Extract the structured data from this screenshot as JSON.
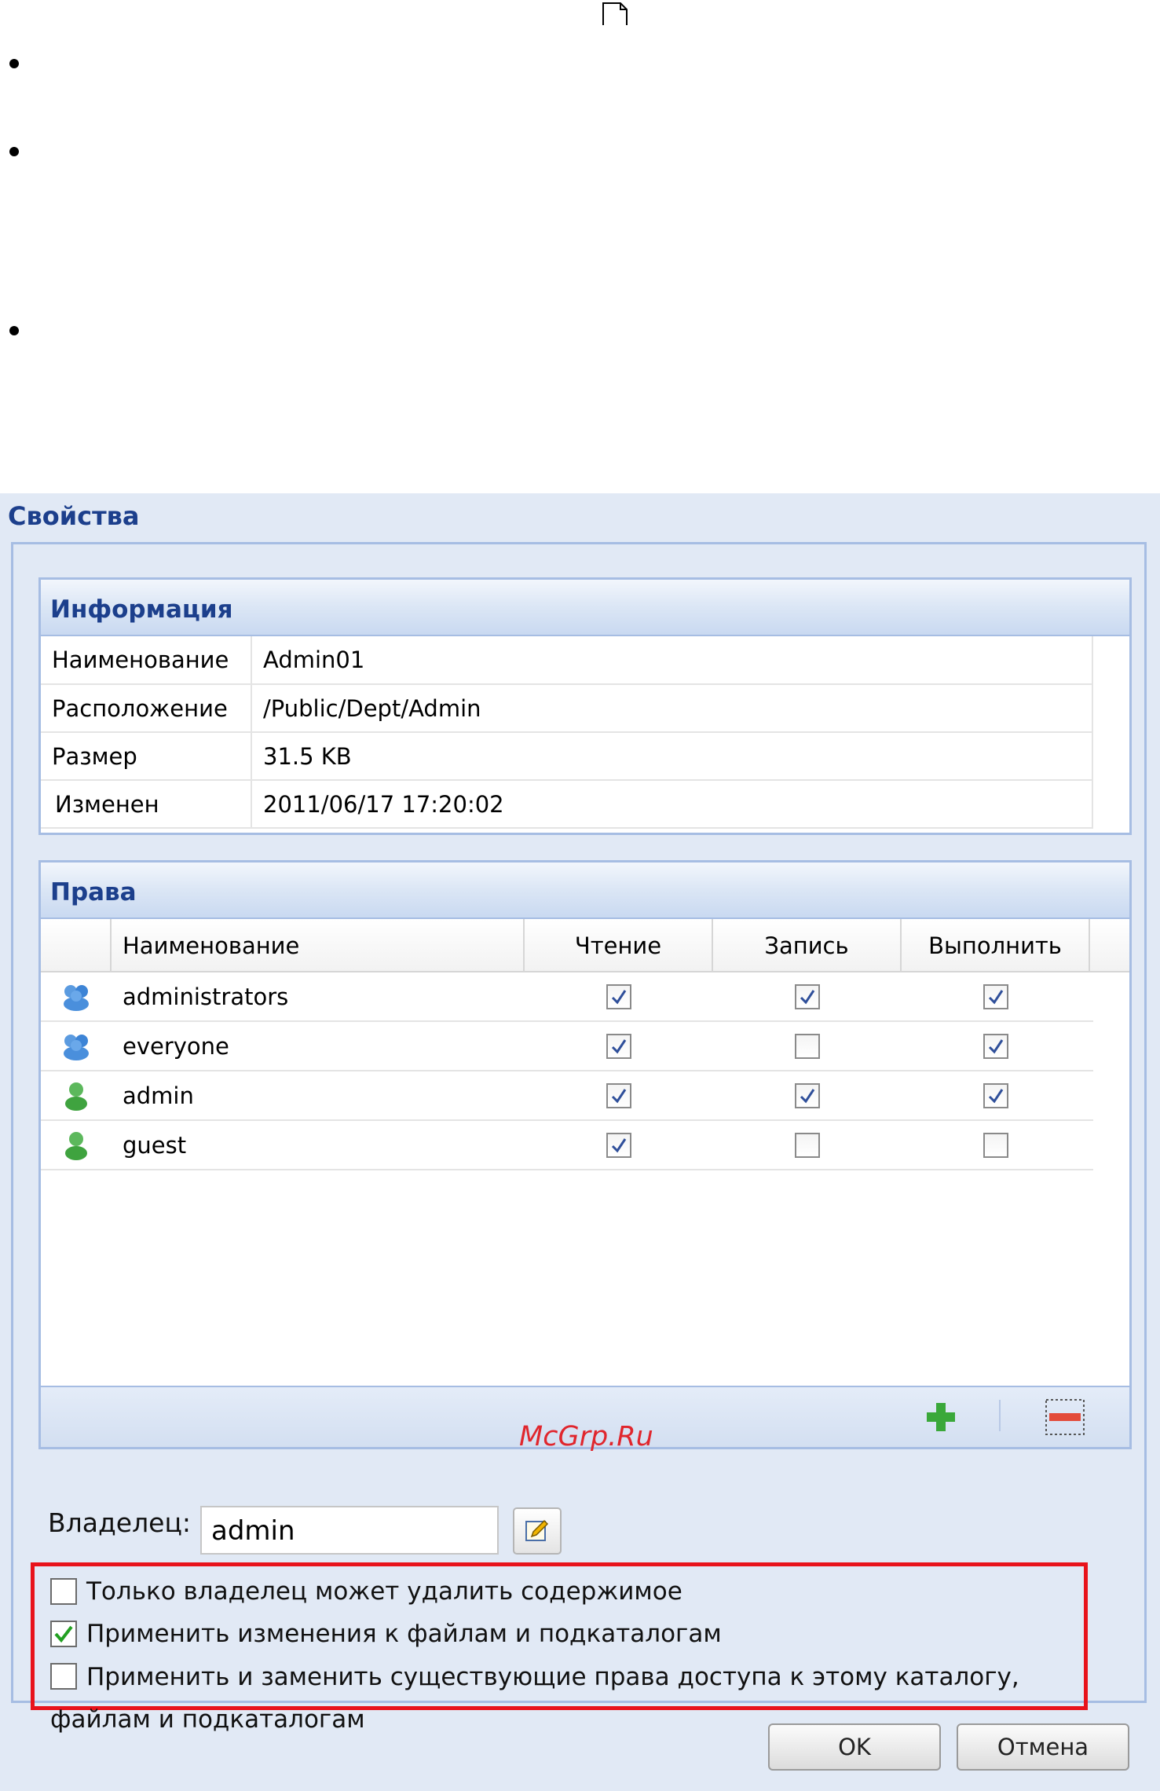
{
  "dialog": {
    "title": "Свойства"
  },
  "info": {
    "title": "Информация",
    "rows": [
      {
        "key": "Наименование",
        "value": "Admin01"
      },
      {
        "key": "Расположение",
        "value": "/Public/Dept/Admin"
      },
      {
        "key": "Размер",
        "value": "31.5 KB"
      },
      {
        "key": "Изменен",
        "value": "2011/06/17 17:20:02"
      }
    ]
  },
  "rights": {
    "title": "Права",
    "columns": {
      "name": "Наименование",
      "read": "Чтение",
      "write": "Запись",
      "execute": "Выполнить"
    },
    "rows": [
      {
        "name": "administrators",
        "icon": "group-icon",
        "read": true,
        "write": true,
        "execute": true
      },
      {
        "name": "everyone",
        "icon": "group-icon",
        "read": true,
        "write": false,
        "execute": true
      },
      {
        "name": "admin",
        "icon": "user-icon",
        "read": true,
        "write": true,
        "execute": true
      },
      {
        "name": "guest",
        "icon": "user-icon",
        "read": true,
        "write": false,
        "execute": false
      }
    ]
  },
  "owner": {
    "label": "Владелец:",
    "value": "admin"
  },
  "options": [
    {
      "label": "Только владелец может удалить содержимое",
      "checked": false
    },
    {
      "label": "Применить изменения к файлам и подкаталогам",
      "checked": true
    },
    {
      "label": "Применить и заменить существующие права доступа к этому каталогу, файлам и подкаталогам",
      "checked": false
    }
  ],
  "buttons": {
    "ok": "OK",
    "cancel": "Отмена"
  },
  "watermark": "McGrp.Ru",
  "colors": {
    "highlight_border": "#e8131b",
    "title_blue": "#1c3f8c",
    "dialog_bg": "#e1e9f5"
  }
}
